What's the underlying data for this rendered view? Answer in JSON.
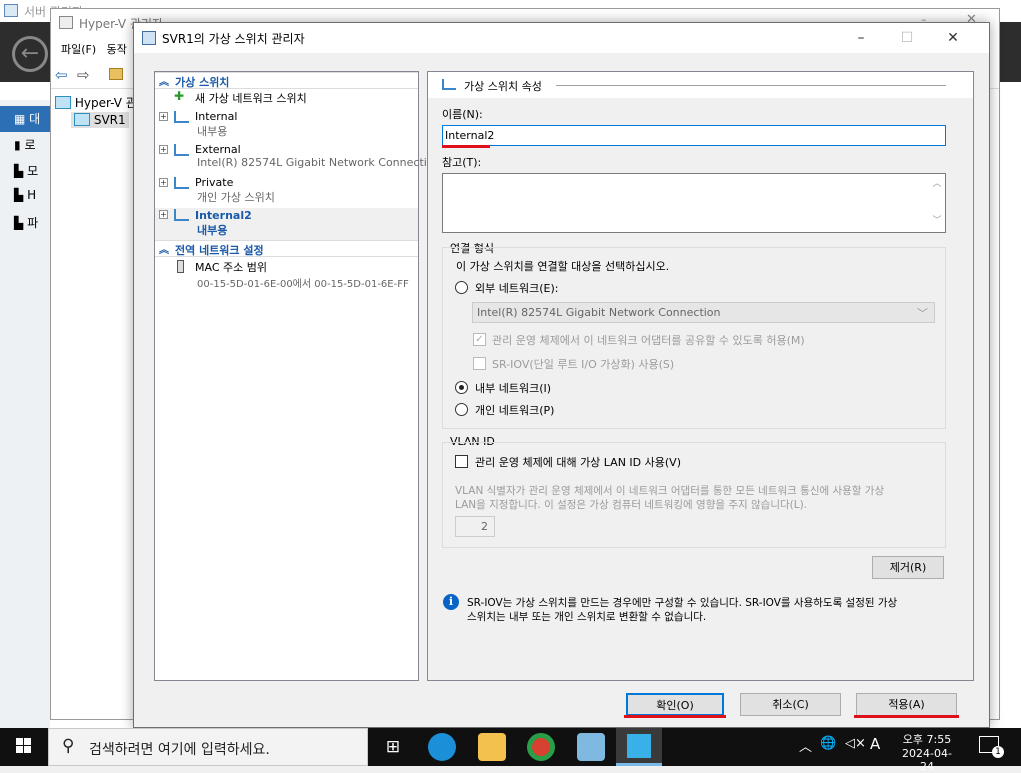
{
  "server_manager": {
    "title": "서버 관리자",
    "nav": [
      "대",
      "로",
      "모",
      "H",
      "파"
    ]
  },
  "hyperv": {
    "title": "Hyper-V 관리자",
    "menu": [
      "파일(F)",
      "동작"
    ],
    "tree": [
      "Hyper-V 관",
      "SVR1"
    ]
  },
  "dialog": {
    "title": "SVR1의 가상 스위치 관리자",
    "left": {
      "sec_switches": "가상 스위치",
      "new_switch": "새 가상 네트워크 스위치",
      "switches": [
        {
          "name": "Internal",
          "sub": "내부용"
        },
        {
          "name": "External",
          "sub": "Intel(R) 82574L Gigabit Network Connection"
        },
        {
          "name": "Private",
          "sub": "개인 가상 스위치"
        },
        {
          "name": "Internal2",
          "sub": "내부용"
        }
      ],
      "sec_global": "전역 네트워크 설정",
      "mac_label": "MAC 주소 범위",
      "mac_range": "00-15-5D-01-6E-00에서 00-15-5D-01-6E-FF"
    },
    "props": {
      "header": "가상 스위치 속성",
      "name_label": "이름(N):",
      "name_value": "Internal2",
      "note_label": "참고(T):",
      "conn_type": "연결 형식",
      "conn_prompt": "이 가상 스위치를 연결할 대상을 선택하십시오.",
      "external": "외부 네트워크(E):",
      "adapter": "Intel(R) 82574L Gigabit Network Connection",
      "share_os": "관리 운영 체제에서 이 네트워크 어댑터를 공유할 수 있도록 허용(M)",
      "sriov": "SR-IOV(단일 루트 I/O 가상화) 사용(S)",
      "internal": "내부 네트워크(I)",
      "private": "개인 네트워크(P)",
      "vlan_title": "VLAN ID",
      "vlan_enable": "관리 운영 체제에 대해 가상 LAN ID 사용(V)",
      "vlan_desc1": "VLAN 식별자가 관리 운영 체제에서 이 네트워크 어댑터를 통한 모든 네트워크 통신에 사용할 가상",
      "vlan_desc2": "LAN을 지정합니다. 이 설정은 가상 컴퓨터 네트워킹에 영향을 주지 않습니다(L).",
      "vlan_value": "2",
      "remove": "제거(R)",
      "info1": "SR-IOV는 가상 스위치를 만드는 경우에만 구성할 수 있습니다. SR-IOV를 사용하도록 설정된 가상",
      "info2": "스위치는 내부 또는 개인 스위치로 변환할 수 없습니다."
    },
    "buttons": {
      "ok": "확인(O)",
      "cancel": "취소(C)",
      "apply": "적용(A)"
    }
  },
  "taskbar": {
    "search": "검색하려면 여기에 입력하세요.",
    "ime": "A",
    "time": "오후 7:55",
    "date": "2024-04-24",
    "notif": "1"
  }
}
